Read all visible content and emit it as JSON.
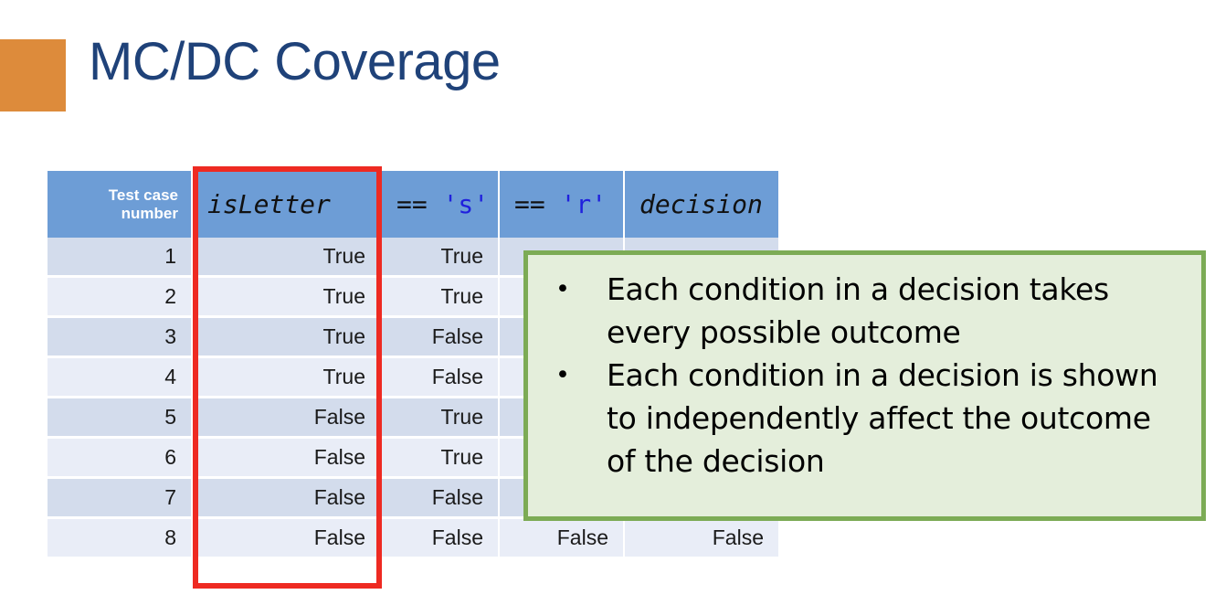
{
  "slide": {
    "title": "MC/DC Coverage",
    "accent_color": "#dd8b3b",
    "title_color": "#1f4279"
  },
  "table": {
    "header_bg": "#6d9dd6",
    "row_colors": [
      "#d3dcec",
      "#e9edf7"
    ],
    "columns": [
      {
        "label": "Test case number",
        "style": "plain"
      },
      {
        "label": "isLetter",
        "style": "code"
      },
      {
        "label": "== 's'",
        "op": "==",
        "literal": "'s'",
        "style": "code"
      },
      {
        "label": "== 'r'",
        "op": "==",
        "literal": "'r'",
        "style": "code"
      },
      {
        "label": "decision",
        "style": "code"
      }
    ],
    "rows": [
      {
        "n": "1",
        "isLetter": "True",
        "eq_s": "True",
        "eq_r": "",
        "decision": ""
      },
      {
        "n": "2",
        "isLetter": "True",
        "eq_s": "True",
        "eq_r": "",
        "decision": ""
      },
      {
        "n": "3",
        "isLetter": "True",
        "eq_s": "False",
        "eq_r": "",
        "decision": ""
      },
      {
        "n": "4",
        "isLetter": "True",
        "eq_s": "False",
        "eq_r": "",
        "decision": ""
      },
      {
        "n": "5",
        "isLetter": "False",
        "eq_s": "True",
        "eq_r": "",
        "decision": ""
      },
      {
        "n": "6",
        "isLetter": "False",
        "eq_s": "True",
        "eq_r": "",
        "decision": ""
      },
      {
        "n": "7",
        "isLetter": "False",
        "eq_s": "False",
        "eq_r": "",
        "decision": ""
      },
      {
        "n": "8",
        "isLetter": "False",
        "eq_s": "False",
        "eq_r": "False",
        "decision": "False"
      }
    ]
  },
  "highlight": {
    "target_column": "isLetter",
    "color": "#ee2a22"
  },
  "callout": {
    "border_color": "#7cab55",
    "background_color": "#e4eedb",
    "bullet_glyph": "•",
    "bullets": [
      "Each condition in a decision takes every possible outcome",
      "Each condition in a decision is shown to independently affect the outcome of the decision"
    ]
  }
}
